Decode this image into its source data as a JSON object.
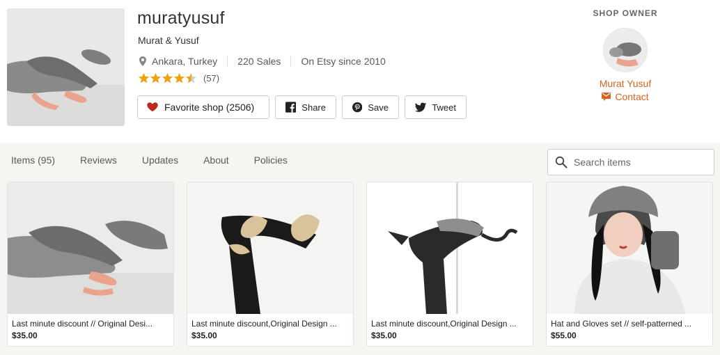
{
  "shop": {
    "name": "muratyusuf",
    "owners_display": "Murat & Yusuf",
    "location": "Ankara, Turkey",
    "sales": "220 Sales",
    "since": "On Etsy since 2010",
    "rating_stars": 4.5,
    "review_count": "(57)"
  },
  "buttons": {
    "favorite": "Favorite shop (2506)",
    "share": "Share",
    "save": "Save",
    "tweet": "Tweet"
  },
  "owner": {
    "label": "SHOP OWNER",
    "name": "Murat Yusuf",
    "contact": "Contact"
  },
  "tabs": [
    {
      "label": "Items (95)"
    },
    {
      "label": "Reviews"
    },
    {
      "label": "Updates"
    },
    {
      "label": "About"
    },
    {
      "label": "Policies"
    }
  ],
  "search": {
    "placeholder": "Search items",
    "value": ""
  },
  "listings": [
    {
      "title": "Last minute discount // Original Desi...",
      "price": "$35.00"
    },
    {
      "title": "Last minute discount,Original Design ...",
      "price": "$35.00"
    },
    {
      "title": "Last minute discount,Original Design ...",
      "price": "$35.00"
    },
    {
      "title": "Hat and Gloves set // self-patterned ...",
      "price": "$55.00"
    }
  ],
  "colors": {
    "accent": "#d5641c",
    "star": "#f1a10d",
    "heart": "#b62b1d",
    "band": "#f5f5f1"
  },
  "icons": [
    "location-pin-icon",
    "star-icon",
    "heart-icon",
    "facebook-icon",
    "pinterest-icon",
    "twitter-icon",
    "mail-icon",
    "search-icon"
  ]
}
